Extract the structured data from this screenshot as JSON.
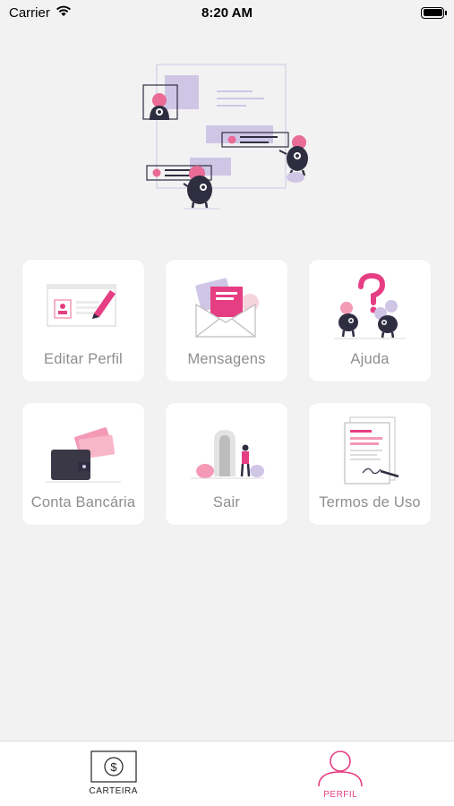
{
  "status": {
    "carrier": "Carrier",
    "time": "8:20 AM"
  },
  "colors": {
    "accent": "#e63e83",
    "pink_light": "#f49ab7",
    "lavender": "#c9bfe1",
    "dark": "#2f2e41"
  },
  "menu": [
    {
      "label": "Editar Perfil",
      "icon": "edit-profile-illustration"
    },
    {
      "label": "Mensagens",
      "icon": "messages-illustration"
    },
    {
      "label": "Ajuda",
      "icon": "help-illustration"
    },
    {
      "label": "Conta Bancária",
      "icon": "wallet-illustration"
    },
    {
      "label": "Sair",
      "icon": "exit-door-illustration"
    },
    {
      "label": "Termos de Uso",
      "icon": "terms-document-illustration"
    }
  ],
  "tabbar": {
    "wallet_label": "CARTEIRA",
    "profile_label": "PERFIL",
    "active": "PERFIL"
  }
}
